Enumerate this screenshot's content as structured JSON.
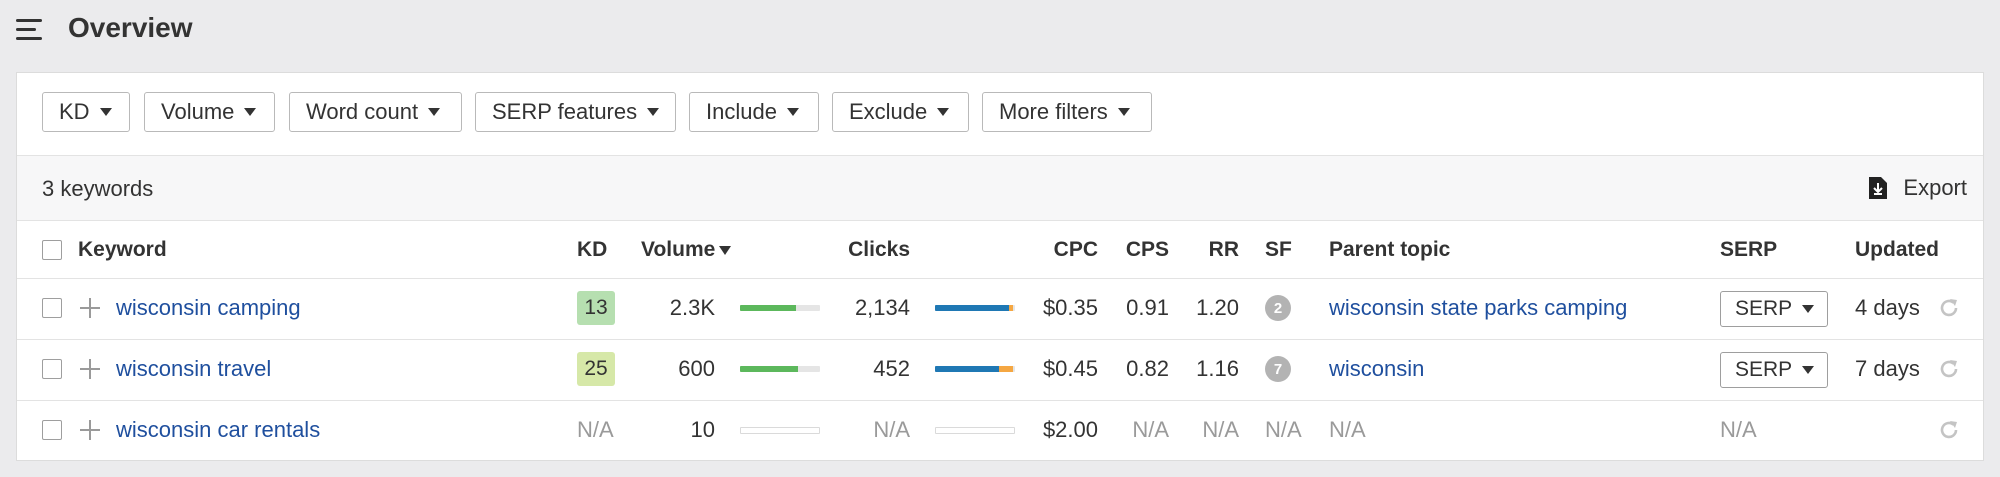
{
  "header": {
    "title": "Overview",
    "menu_icon": "hamburger-menu-icon"
  },
  "filters": [
    {
      "name": "filter-kd",
      "label": "KD"
    },
    {
      "name": "filter-volume",
      "label": "Volume"
    },
    {
      "name": "filter-word-count",
      "label": "Word count"
    },
    {
      "name": "filter-serp-features",
      "label": "SERP features"
    },
    {
      "name": "filter-include",
      "label": "Include"
    },
    {
      "name": "filter-exclude",
      "label": "Exclude"
    },
    {
      "name": "filter-more-filters",
      "label": "More filters"
    }
  ],
  "summary": {
    "count_text": "3 keywords",
    "export_label": "Export",
    "export_icon": "download-file-icon"
  },
  "table": {
    "headers": {
      "keyword": "Keyword",
      "kd": "KD",
      "volume": "Volume",
      "clicks": "Clicks",
      "cpc": "CPC",
      "cps": "CPS",
      "rr": "RR",
      "sf": "SF",
      "parent_topic": "Parent topic",
      "serp": "SERP",
      "updated": "Updated"
    },
    "rows": [
      {
        "keyword": "wisconsin camping",
        "kd": "13",
        "kd_color": "#b6dfb0",
        "volume": "2.3K",
        "volume_bar_fill": 0.7,
        "clicks": "2,134",
        "clicks_bar": {
          "blue": 0.93,
          "orange": 0.04
        },
        "cpc": "$0.35",
        "cps": "0.91",
        "rr": "1.20",
        "sf": "2",
        "parent_topic": "wisconsin state parks camping",
        "serp": "SERP",
        "updated": "4 days"
      },
      {
        "keyword": "wisconsin travel",
        "kd": "25",
        "kd_color": "#d6e8a8",
        "volume": "600",
        "volume_bar_fill": 0.72,
        "clicks": "452",
        "clicks_bar": {
          "blue": 0.8,
          "orange": 0.18
        },
        "cpc": "$0.45",
        "cps": "0.82",
        "rr": "1.16",
        "sf": "7",
        "parent_topic": "wisconsin",
        "serp": "SERP",
        "updated": "7 days"
      },
      {
        "keyword": "wisconsin car rentals",
        "kd": "N/A",
        "volume": "10",
        "clicks": "N/A",
        "cpc": "$2.00",
        "cps": "N/A",
        "rr": "N/A",
        "sf": "N/A",
        "parent_topic": "N/A",
        "serp": "N/A",
        "updated": ""
      }
    ]
  },
  "colors": {
    "link": "#1f4f9e",
    "volume_bar": "#5cb85c",
    "clicks_blue": "#1f78b4",
    "clicks_orange": "#f5a742",
    "bar_track": "#e5e5e5"
  }
}
